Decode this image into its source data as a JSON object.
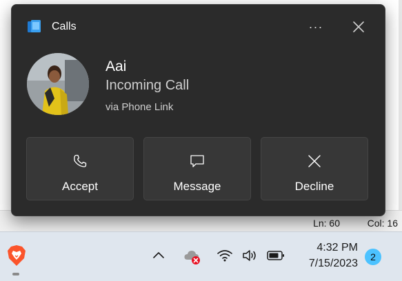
{
  "toast": {
    "app_name": "Calls",
    "more_label": "···",
    "caller_name": "Aai",
    "status": "Incoming Call",
    "via": "via Phone Link",
    "actions": [
      {
        "label": "Accept",
        "icon": "phone-icon"
      },
      {
        "label": "Message",
        "icon": "message-icon"
      },
      {
        "label": "Decline",
        "icon": "close-icon"
      }
    ]
  },
  "statusbar": {
    "ln": "Ln: 60",
    "col": "Col: 16"
  },
  "taskbar": {
    "time": "4:32 PM",
    "date": "7/15/2023",
    "notification_count": "2"
  },
  "colors": {
    "toast_bg": "#2b2b2b",
    "button_bg": "#373737",
    "badge": "#4cc2ff",
    "taskbar_bg": "#dfe6ee"
  }
}
